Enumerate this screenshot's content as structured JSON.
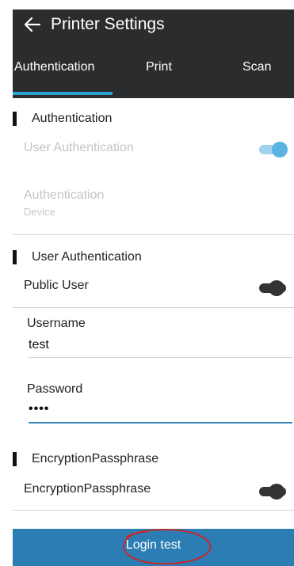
{
  "header": {
    "title": "Printer Settings",
    "tabs": [
      {
        "label": "Authentication",
        "active": true
      },
      {
        "label": "Print",
        "active": false
      },
      {
        "label": "Scan",
        "active": false
      }
    ]
  },
  "sections": {
    "authentication": {
      "title": "Authentication",
      "user_authentication_label": "User Authentication",
      "user_authentication_enabled": true,
      "authentication_label": "Authentication",
      "authentication_value": "Device"
    },
    "user_authentication": {
      "title": "User Authentication",
      "public_user_label": "Public User",
      "public_user_enabled": false,
      "username_label": "Username",
      "username_value": "test",
      "password_label": "Password",
      "password_value": "••••"
    },
    "encryption": {
      "title": "EncryptionPassphrase",
      "toggle_label": "EncryptionPassphrase",
      "toggle_enabled": false
    }
  },
  "actions": {
    "login_test_label": "Login test"
  },
  "colors": {
    "header_bg": "#2a2c2e",
    "accent": "#2aa0d6",
    "button_bg": "#2b7db3",
    "annotation": "#d42020"
  }
}
